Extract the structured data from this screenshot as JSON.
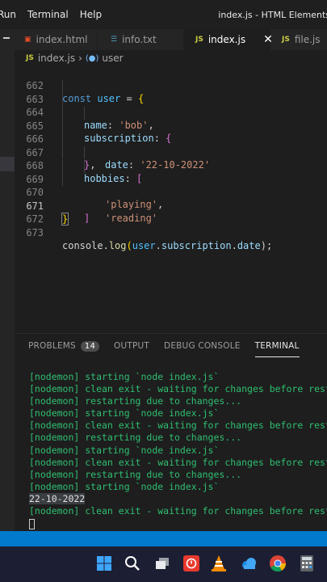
{
  "menubar": {
    "items": [
      "Run",
      "Terminal",
      "Help"
    ],
    "window_title": "index.js - HTML Elements"
  },
  "tabs": [
    {
      "label": "index.html",
      "icon": "html5-icon",
      "active": false
    },
    {
      "label": "info.txt",
      "icon": "text-file-icon",
      "active": false
    },
    {
      "label": "index.js",
      "icon": "javascript-icon",
      "active": true
    },
    {
      "label": "file.js",
      "icon": "javascript-icon",
      "active": false
    }
  ],
  "breadcrumb": {
    "file": "index.js",
    "symbol": "user"
  },
  "editor": {
    "line_numbers": [
      "662",
      "663",
      "664",
      "665",
      "666",
      "667",
      "668",
      "669",
      "670",
      "671",
      "672",
      "673"
    ],
    "current_line": "671",
    "code": {
      "l662_kw": "const",
      "l662_var": "user",
      "l662_op": " = ",
      "l662_br": "{",
      "l663_prop": "name",
      "l663_colon": ": ",
      "l663_str": "'bob'",
      "l663_comma": ",",
      "l664_prop": "subscription",
      "l664_colon": ": ",
      "l664_br": "{",
      "l665_prop": "date",
      "l665_colon": ": ",
      "l665_str": "'22-10-2022'",
      "l666_br": "}",
      "l666_comma": ",",
      "l667_prop": "hobbies",
      "l667_colon": ": ",
      "l667_br": "[",
      "l668_str": "'playing'",
      "l668_comma": ",",
      "l669_str": "'reading'",
      "l670_br": "]",
      "l671_br": "}",
      "l673_obj": "console",
      "l673_dot1": ".",
      "l673_fn": "log",
      "l673_open": "(",
      "l673_var": "user",
      "l673_dot2": ".",
      "l673_prop1": "subscription",
      "l673_dot3": ".",
      "l673_prop2": "date",
      "l673_close": ");"
    }
  },
  "panel": {
    "tabs": [
      "PROBLEMS",
      "OUTPUT",
      "DEBUG CONSOLE",
      "TERMINAL"
    ],
    "problems_count": "14",
    "active_tab": "TERMINAL",
    "terminal_lines": [
      "[nodemon] starting `node index.js`",
      "[nodemon] clean exit - waiting for changes before restart",
      "[nodemon] restarting due to changes...",
      "[nodemon] starting `node index.js`",
      "[nodemon] clean exit - waiting for changes before restart",
      "[nodemon] restarting due to changes...",
      "[nodemon] starting `node index.js`",
      "[nodemon] clean exit - waiting for changes before restart",
      "[nodemon] restarting due to changes...",
      "[nodemon] starting `node index.js`"
    ],
    "output_line": "22-10-2022",
    "last_line": "[nodemon] clean exit - waiting for changes before restart"
  },
  "taskbar": {
    "icons": [
      "windows-start-icon",
      "search-icon",
      "task-view-icon",
      "anydesk-icon",
      "vlc-icon",
      "cloud-app-icon",
      "chrome-icon",
      "calculator-icon"
    ]
  },
  "colors": {
    "accent_blue": "#007acc",
    "keyword": "#569cd6",
    "string": "#ce9178",
    "terminal_green": "#2fbf71",
    "taskbar": "#1c1f33"
  }
}
